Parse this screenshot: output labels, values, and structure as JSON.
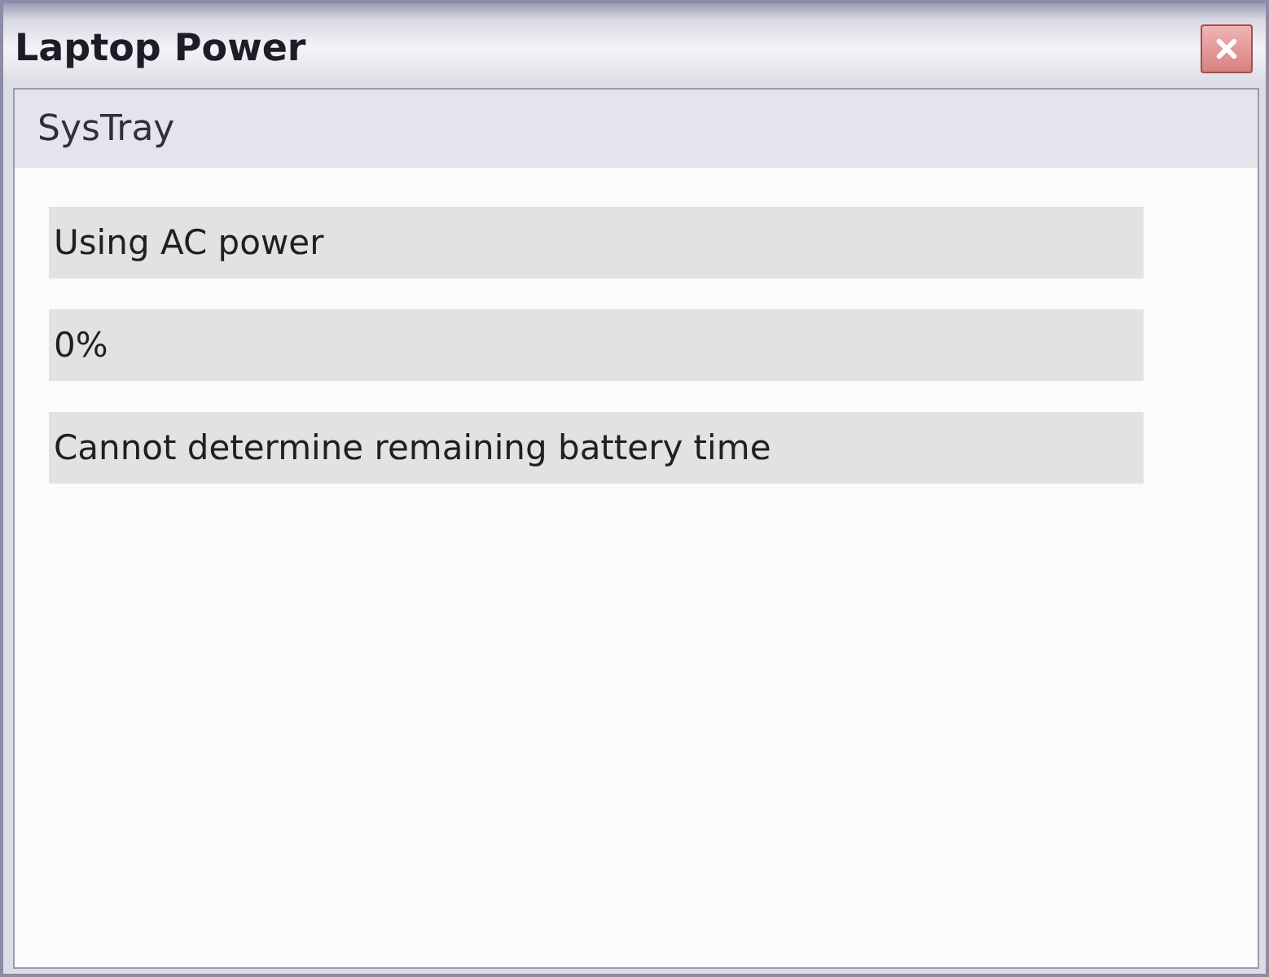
{
  "window": {
    "title": "Laptop Power"
  },
  "section": {
    "title": "SysTray"
  },
  "rows": [
    {
      "text": "Using AC power"
    },
    {
      "text": "0%"
    },
    {
      "text": "Cannot determine remaining battery time"
    }
  ]
}
